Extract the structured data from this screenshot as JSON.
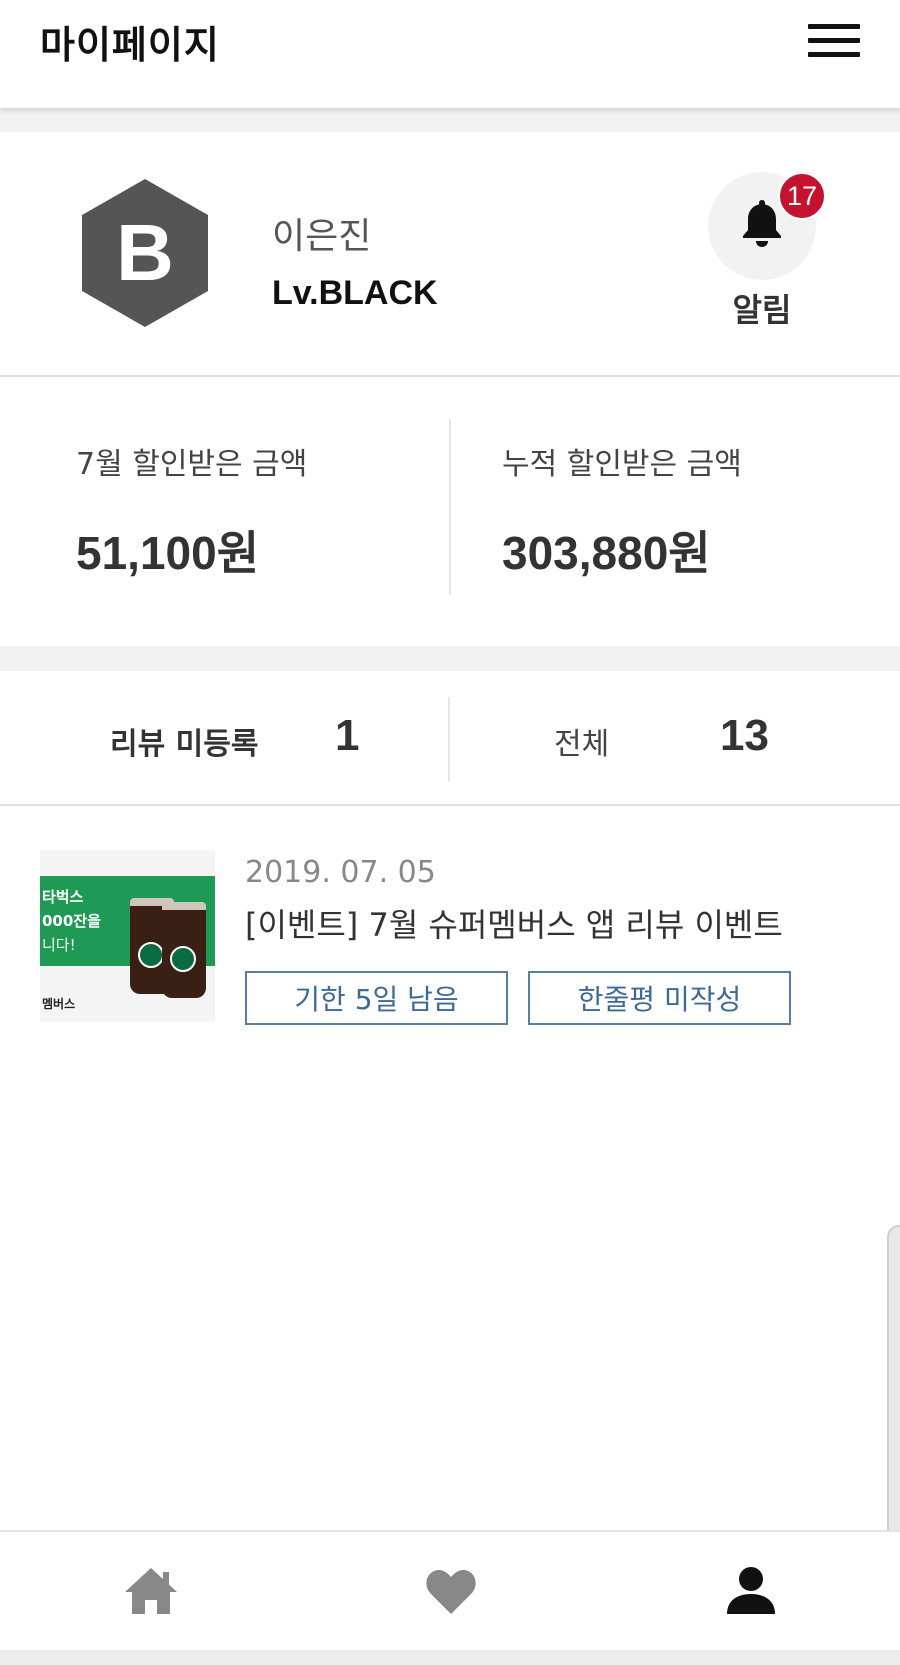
{
  "header": {
    "title": "마이페이지",
    "menu_icon": "hamburger-menu-icon"
  },
  "profile": {
    "grade_letter": "B",
    "grade_color": "#555555",
    "name": "이은진",
    "level": "Lv.BLACK",
    "alarm": {
      "icon": "bell-icon",
      "badge_count": "17",
      "badge_color": "#c4122f",
      "label": "알림"
    }
  },
  "discount": {
    "monthly": {
      "label": "7월 할인받은 금액",
      "value": "51,100원"
    },
    "cumulative": {
      "label": "누적 할인받은 금액",
      "value": "303,880원"
    }
  },
  "review_stats": {
    "unregistered": {
      "label": "리뷰 미등록",
      "count": "1"
    },
    "total": {
      "label": "전체",
      "count": "13"
    }
  },
  "events": [
    {
      "thumbnail_text": [
        "타벅스",
        "000잔을",
        "니다!"
      ],
      "thumbnail_footer": "멤버스",
      "date": "2019. 07. 05",
      "title": "[이벤트] 7월 슈퍼멤버스 앱 리뷰 이벤트",
      "tags": [
        "기한 5일 남음",
        "한줄평 미작성"
      ],
      "tag_color": "#3d6a95"
    }
  ],
  "bottom_nav": {
    "items": [
      {
        "icon": "home-icon",
        "active": false
      },
      {
        "icon": "heart-icon",
        "active": false
      },
      {
        "icon": "person-icon",
        "active": true
      }
    ],
    "inactive_color": "#888888",
    "active_color": "#111111"
  }
}
